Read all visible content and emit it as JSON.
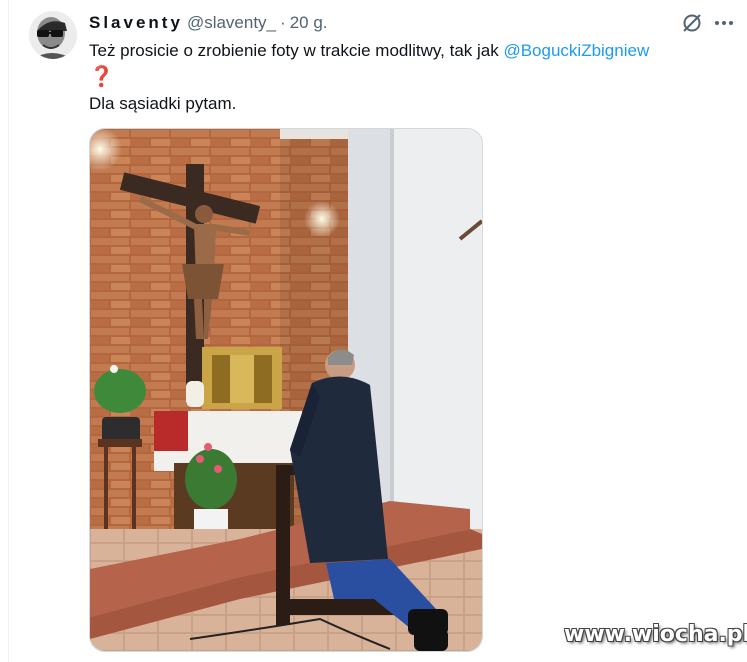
{
  "tweet": {
    "display_name": "Slaventy",
    "handle": "@slaventy_",
    "separator": "·",
    "time": "20 g.",
    "text_line1": "Też prosicie o zrobienie foty w trakcie modlitwy, tak jak ",
    "mention": "@BoguckiZbigniew",
    "emoji": "❓",
    "text_line2": "Dla sąsiadki pytam."
  },
  "icons": {
    "grok": "grok-icon",
    "more": "more-icon"
  },
  "watermark": "www.wiocha.pl",
  "colors": {
    "mention": "#1d9bf0",
    "text": "#0f1419",
    "secondary": "#536471"
  }
}
